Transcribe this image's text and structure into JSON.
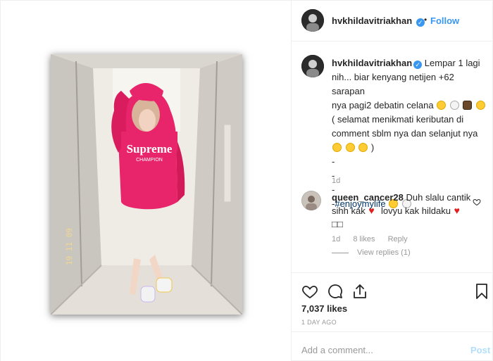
{
  "header": {
    "username": "hvkhildavitriakhan",
    "verified_glyph": "✓",
    "separator": "•",
    "follow_label": "Follow"
  },
  "caption": {
    "username": "hvkhildavitriakhan",
    "line1": "Lempar 1 lagi",
    "line2": "nih... biar kenyang netijen +62 sarapan",
    "line3": "nya pagi2 debatin celana",
    "line4": "( selamat menikmati keributan di",
    "line5": "comment sblm nya dan selanjut nya",
    "line6": ")",
    "dash1": "-",
    "dash2": "-",
    "dash3": "-",
    "hashtag_prefix": "-",
    "hashtag": "#enjoymylife",
    "time": "1d"
  },
  "comment": {
    "username": "queen_cancer28",
    "text1": "Duh slalu cantik",
    "text2": "sihh kak",
    "text3": "lovyu kak hildaku",
    "text4": "□□",
    "time": "1d",
    "likes": "8 likes",
    "reply_label": "Reply",
    "view_replies": "View replies (1)"
  },
  "photo": {
    "hoodie_brand": "Supreme",
    "hoodie_sub": "CHAMPION",
    "date_stamp": "19 11 09"
  },
  "stats": {
    "likes": "7,037 likes",
    "post_time": "1 DAY AGO"
  },
  "add_comment": {
    "placeholder": "Add a comment...",
    "post_label": "Post"
  },
  "icons": {
    "like": "heart-outline-icon",
    "comment": "speech-bubble-icon",
    "share": "share-upload-icon",
    "save": "bookmark-icon"
  },
  "colors": {
    "link_blue": "#3897f0",
    "hoodie_pink": "#e8246a",
    "muted_gray": "#999999"
  }
}
